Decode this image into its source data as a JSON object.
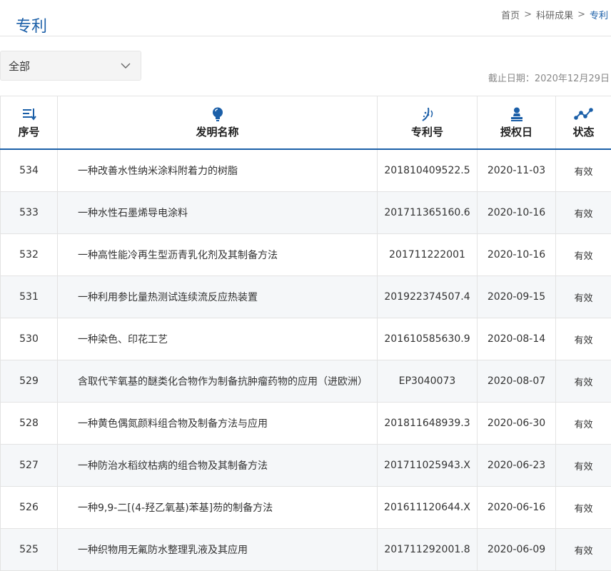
{
  "page": {
    "title": "专利"
  },
  "breadcrumb": {
    "home": "首页",
    "research": "科研成果",
    "current": "专利",
    "separator": ">"
  },
  "filter": {
    "selected": "全部"
  },
  "deadline": "截止日期：2020年12月29日",
  "table": {
    "headers": {
      "index": "序号",
      "name": "发明名称",
      "patent_no": "专利号",
      "grant_date": "授权日",
      "status": "状态"
    },
    "rows": [
      {
        "index": "534",
        "name": "一种改善水性纳米涂料附着力的树脂",
        "patent_no": "201810409522.5",
        "grant_date": "2020-11-03",
        "status": "有效"
      },
      {
        "index": "533",
        "name": "一种水性石墨烯导电涂料",
        "patent_no": "201711365160.6",
        "grant_date": "2020-10-16",
        "status": "有效"
      },
      {
        "index": "532",
        "name": "一种高性能冷再生型沥青乳化剂及其制备方法",
        "patent_no": "201711222001",
        "grant_date": "2020-10-16",
        "status": "有效"
      },
      {
        "index": "531",
        "name": "一种利用参比量热测试连续流反应热装置",
        "patent_no": "201922374507.4",
        "grant_date": "2020-09-15",
        "status": "有效"
      },
      {
        "index": "530",
        "name": "一种染色、印花工艺",
        "patent_no": "201610585630.9",
        "grant_date": "2020-08-14",
        "status": "有效"
      },
      {
        "index": "529",
        "name": "含取代苄氧基的醚类化合物作为制备抗肿瘤药物的应用（进欧洲）",
        "patent_no": "EP3040073",
        "grant_date": "2020-08-07",
        "status": "有效"
      },
      {
        "index": "528",
        "name": "一种黄色偶氮颜料组合物及制备方法与应用",
        "patent_no": "201811648939.3",
        "grant_date": "2020-06-30",
        "status": "有效"
      },
      {
        "index": "527",
        "name": "一种防治水稻纹枯病的组合物及其制备方法",
        "patent_no": "201711025943.X",
        "grant_date": "2020-06-23",
        "status": "有效"
      },
      {
        "index": "526",
        "name": "一种9,9-二[(4-羟乙氧基)苯基]芴的制备方法",
        "patent_no": "201611120644.X",
        "grant_date": "2020-06-16",
        "status": "有效"
      },
      {
        "index": "525",
        "name": "一种织物用无氟防水整理乳液及其应用",
        "patent_no": "201711292001.8",
        "grant_date": "2020-06-09",
        "status": "有效"
      }
    ]
  },
  "icons": {
    "index": "sort-list-icon",
    "name": "lightbulb-icon",
    "patent_no": "patent-signal-icon",
    "grant_date": "stamp-icon",
    "status": "status-network-icon"
  },
  "colors": {
    "accent": "#1b5fa8",
    "row_alt": "#f5f7f9",
    "border": "#e3e3e3"
  }
}
